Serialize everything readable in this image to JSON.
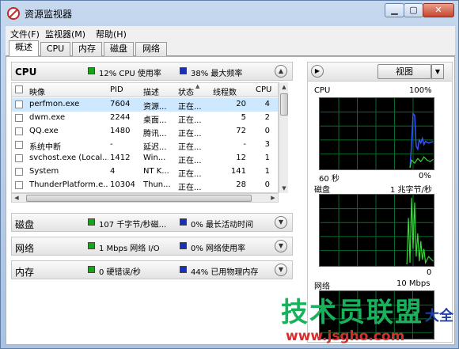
{
  "window": {
    "title": "资源监视器"
  },
  "menu": [
    "文件(F)",
    "监视器(M)",
    "帮助(H)"
  ],
  "tabs": [
    "概述",
    "CPU",
    "内存",
    "磁盘",
    "网络"
  ],
  "cpu_section": {
    "title": "CPU",
    "usage": "12% CPU 使用率",
    "freq": "38% 最大频率",
    "columns": [
      "映像",
      "PID",
      "描述",
      "状态",
      "线程数",
      "CPU"
    ],
    "rows": [
      {
        "image": "perfmon.exe",
        "pid": "7604",
        "desc": "资源...",
        "status": "正在...",
        "threads": "20",
        "cpu": "4"
      },
      {
        "image": "dwm.exe",
        "pid": "2244",
        "desc": "桌面...",
        "status": "正在...",
        "threads": "5",
        "cpu": "2"
      },
      {
        "image": "QQ.exe",
        "pid": "1480",
        "desc": "腾讯...",
        "status": "正在...",
        "threads": "72",
        "cpu": "0"
      },
      {
        "image": "系统中断",
        "pid": "-",
        "desc": "延迟...",
        "status": "正在...",
        "threads": "-",
        "cpu": "3"
      },
      {
        "image": "svchost.exe (Local...",
        "pid": "1412",
        "desc": "Win...",
        "status": "正在...",
        "threads": "12",
        "cpu": "1"
      },
      {
        "image": "System",
        "pid": "4",
        "desc": "NT K...",
        "status": "正在...",
        "threads": "141",
        "cpu": "1"
      },
      {
        "image": "ThunderPlatform.e...",
        "pid": "10304",
        "desc": "Thun...",
        "status": "正在...",
        "threads": "28",
        "cpu": "0"
      }
    ]
  },
  "disk_section": {
    "title": "磁盘",
    "left": "107 千字节/秒磁...",
    "right": "0% 最长活动时间"
  },
  "network_section": {
    "title": "网络",
    "left": "1 Mbps 网络 I/O",
    "right": "0% 网络使用率"
  },
  "memory_section": {
    "title": "内存",
    "left": "0 硬错误/秒",
    "right": "44% 已用物理内存"
  },
  "right_panel": {
    "view_label": "视图",
    "cpu_graph": {
      "label": "CPU",
      "max": "100%",
      "time": "60 秒",
      "min": "0%"
    },
    "disk_graph": {
      "label": "磁盘",
      "max": "1 兆字节/秒",
      "min": "0"
    },
    "net_graph": {
      "label": "网络",
      "max": "10 Mbps"
    }
  },
  "watermark": {
    "main": "技术员联盟",
    "side": "大全",
    "url": "www.jsgho.com"
  },
  "colors": {
    "graph_bg": "#000000",
    "graph_grid": "#0a6e2a",
    "graph_green": "#33dd33",
    "graph_blue": "#3355ff"
  }
}
